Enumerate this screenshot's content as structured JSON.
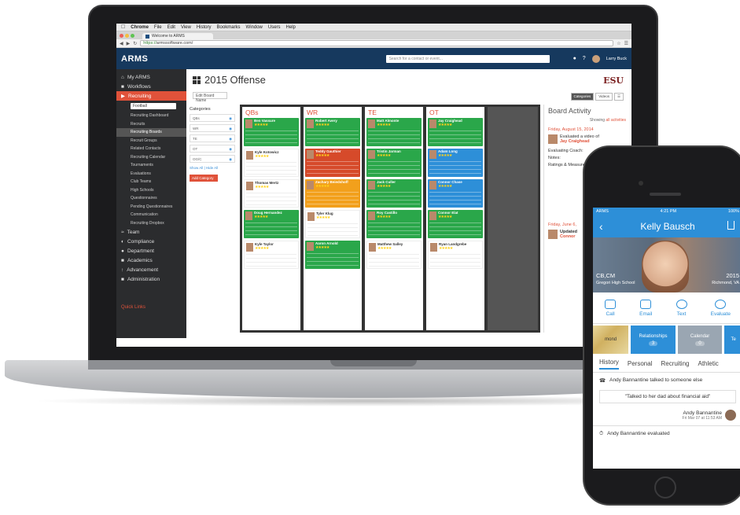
{
  "mac_menu": {
    "app": "Chrome",
    "items": [
      "File",
      "Edit",
      "View",
      "History",
      "Bookmarks",
      "Window",
      "Users",
      "Help"
    ]
  },
  "browser": {
    "tab_title": "Welcome to ARMS",
    "url_scheme": "https://",
    "url_host": "armssoftware.com/"
  },
  "header": {
    "logo": "ARMS",
    "search_placeholder": "Search for a contact or event...",
    "user": "Larry Buck"
  },
  "sidebar": {
    "items": [
      "My ARMS",
      "Workflows",
      "Recruiting"
    ],
    "sport": "Football",
    "sub_items": [
      "Recruiting Dashboard",
      "Recruits",
      "Recruiting Boards",
      "Recruit Groups",
      "Related Contacts",
      "Recruiting Calendar",
      "Tournaments",
      "Evaluations",
      "Club Teams",
      "High Schools",
      "Questionnaires",
      "Pending Questionnaires",
      "Communication",
      "Recruiting Dropbox"
    ],
    "bottom_items": [
      "Team",
      "Compliance",
      "Department",
      "Academics",
      "Advancement",
      "Administration"
    ],
    "quick_links": "Quick Links"
  },
  "main": {
    "title": "2015 Offense",
    "edit_button": "Edit Board Name",
    "logo_text": "ESU",
    "view_buttons": [
      "Categories",
      "Videos"
    ],
    "categories_title": "Categories",
    "categories": [
      "QBs",
      "WR",
      "TE",
      "OT",
      "OG/C"
    ],
    "category_links": "Show All | Hide All",
    "add_category": "Add Category"
  },
  "board": {
    "columns": [
      {
        "name": "QBs",
        "cards": [
          {
            "name": "Ben Vassure",
            "color": "green"
          },
          {
            "name": "Kyle Kotowicz",
            "color": "white"
          },
          {
            "name": "Thomas Mertz",
            "color": "white"
          },
          {
            "name": "Doug Hernandez",
            "color": "green"
          },
          {
            "name": "Kyle Taylor",
            "color": "white"
          }
        ]
      },
      {
        "name": "WR",
        "cards": [
          {
            "name": "Robert Avery",
            "color": "green"
          },
          {
            "name": "Teddy Gauthier",
            "color": "red"
          },
          {
            "name": "Zachary Beiedshoff",
            "color": "orange"
          },
          {
            "name": "Tyler Klug",
            "color": "white"
          },
          {
            "name": "Aaron Arnold",
            "color": "green"
          }
        ]
      },
      {
        "name": "TE",
        "cards": [
          {
            "name": "Matt Almonte",
            "color": "green"
          },
          {
            "name": "Tristin Jarman",
            "color": "green"
          },
          {
            "name": "Jack Culler",
            "color": "green"
          },
          {
            "name": "Roy Castillo",
            "color": "green"
          },
          {
            "name": "Matthew Salley",
            "color": "white"
          }
        ]
      },
      {
        "name": "OT",
        "cards": [
          {
            "name": "Jay Craighead",
            "color": "green"
          },
          {
            "name": "Adam Long",
            "color": "blue"
          },
          {
            "name": "Connor Chase",
            "color": "blue"
          },
          {
            "name": "Connor Elat",
            "color": "green"
          },
          {
            "name": "Ryan Landgrebe",
            "color": "white"
          }
        ]
      }
    ]
  },
  "activity": {
    "title": "Board Activity",
    "showing_label": "Showing",
    "showing_value": "all activities",
    "date1": "Friday, August 15, 2014",
    "entry1": "Evaluated a video of",
    "entry1_who": "Jay Craighead",
    "entry2": "Evaluating Coach:",
    "entry3": "Notes:",
    "entry4": "Ratings & Measure",
    "date2": "Friday, June 6,",
    "entry5": "Updated",
    "entry5_who": "Connor"
  },
  "phone": {
    "carrier": "ARMS",
    "time": "4:21 PM",
    "battery": "100%",
    "name": "Kelly Bausch",
    "position": "CB,CM",
    "school": "Gregori High School",
    "year": "2015",
    "city": "Richmond, VA",
    "actions": [
      "Call",
      "Email",
      "Text",
      "Evaluate"
    ],
    "tiles": {
      "map": "mond",
      "relationships": "Relationships",
      "rel_count": "3",
      "calendar": "Calendar",
      "cal_count": "0",
      "te": "Te"
    },
    "tabs": [
      "History",
      "Personal",
      "Recruiting",
      "Athletic"
    ],
    "feed1": "Andy Bannantine talked to someone else",
    "quote": "\"Talked to her dad about financial aid\"",
    "sig_name": "Andy Bannantine",
    "sig_date": "Fri Mar 07 at 11:53 AM",
    "feed2": "Andy Bannantine evaluated"
  }
}
